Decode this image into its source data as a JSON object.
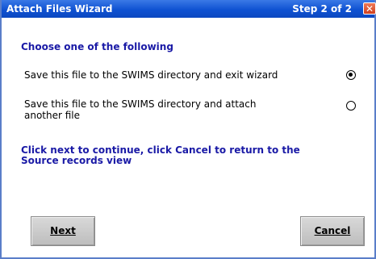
{
  "window": {
    "title": "Attach Files Wizard",
    "step": "Step 2 of 2",
    "close_glyph": "✕"
  },
  "content": {
    "heading": "Choose one of the following",
    "options": [
      {
        "label": "Save this file to the SWIMS directory and exit wizard",
        "selected": true
      },
      {
        "label": "Save this file to the SWIMS directory and attach another file",
        "selected": false
      }
    ],
    "instruction": "Click next to continue, click Cancel to return to the Source records view"
  },
  "buttons": {
    "next_label": "Next",
    "cancel_label": "Cancel"
  },
  "colors": {
    "titlebar": "#0f52d2",
    "heading": "#1a1aa6"
  },
  "icons": {
    "close": "close-icon",
    "radio_selected": "radio-selected-icon",
    "radio_unselected": "radio-unselected-icon"
  }
}
